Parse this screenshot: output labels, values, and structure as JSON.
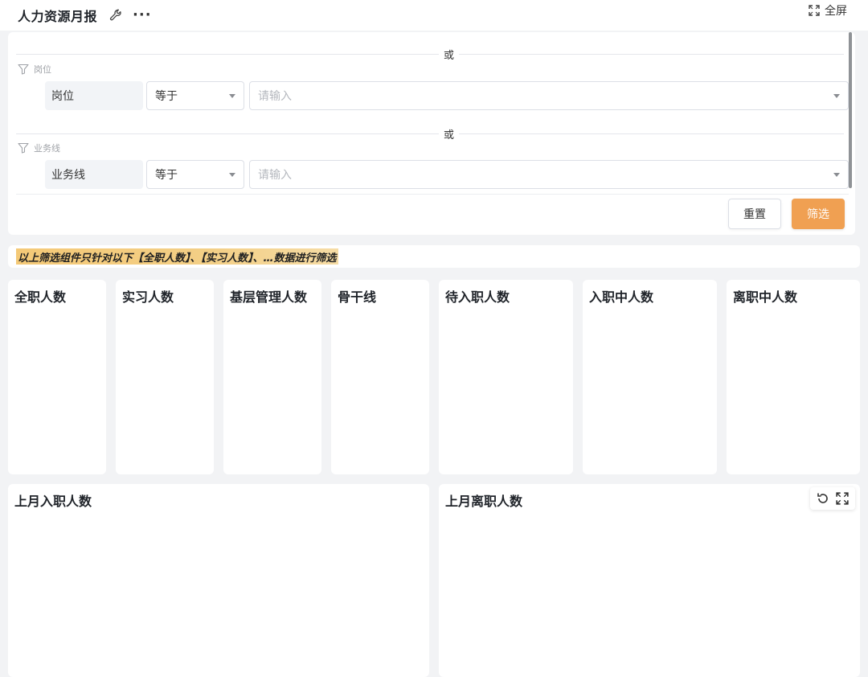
{
  "header": {
    "title": "人力资源月报",
    "fullscreen_label": "全屏"
  },
  "filter": {
    "or_label": "或",
    "groups": [
      {
        "label": "岗位",
        "field": "岗位",
        "operator": "等于",
        "value_placeholder": "请输入"
      },
      {
        "label": "业务线",
        "field": "业务线",
        "operator": "等于",
        "value_placeholder": "请输入"
      }
    ],
    "reset_label": "重置",
    "submit_label": "筛选"
  },
  "notice": {
    "text": "以上筛选组件只针对以下【全职人数】、【实习人数】、…数据进行筛选"
  },
  "cards": [
    {
      "title": "全职人数"
    },
    {
      "title": "实习人数"
    },
    {
      "title": "基层管理人数"
    },
    {
      "title": "骨干线"
    },
    {
      "title": "待入职人数"
    },
    {
      "title": "入职中人数"
    },
    {
      "title": "离职中人数"
    }
  ],
  "bottom_cards": [
    {
      "title": "上月入职人数"
    },
    {
      "title": "上月离职人数"
    }
  ],
  "colors": {
    "accent": "#f0a052",
    "notice_highlight": "#f4c977"
  }
}
